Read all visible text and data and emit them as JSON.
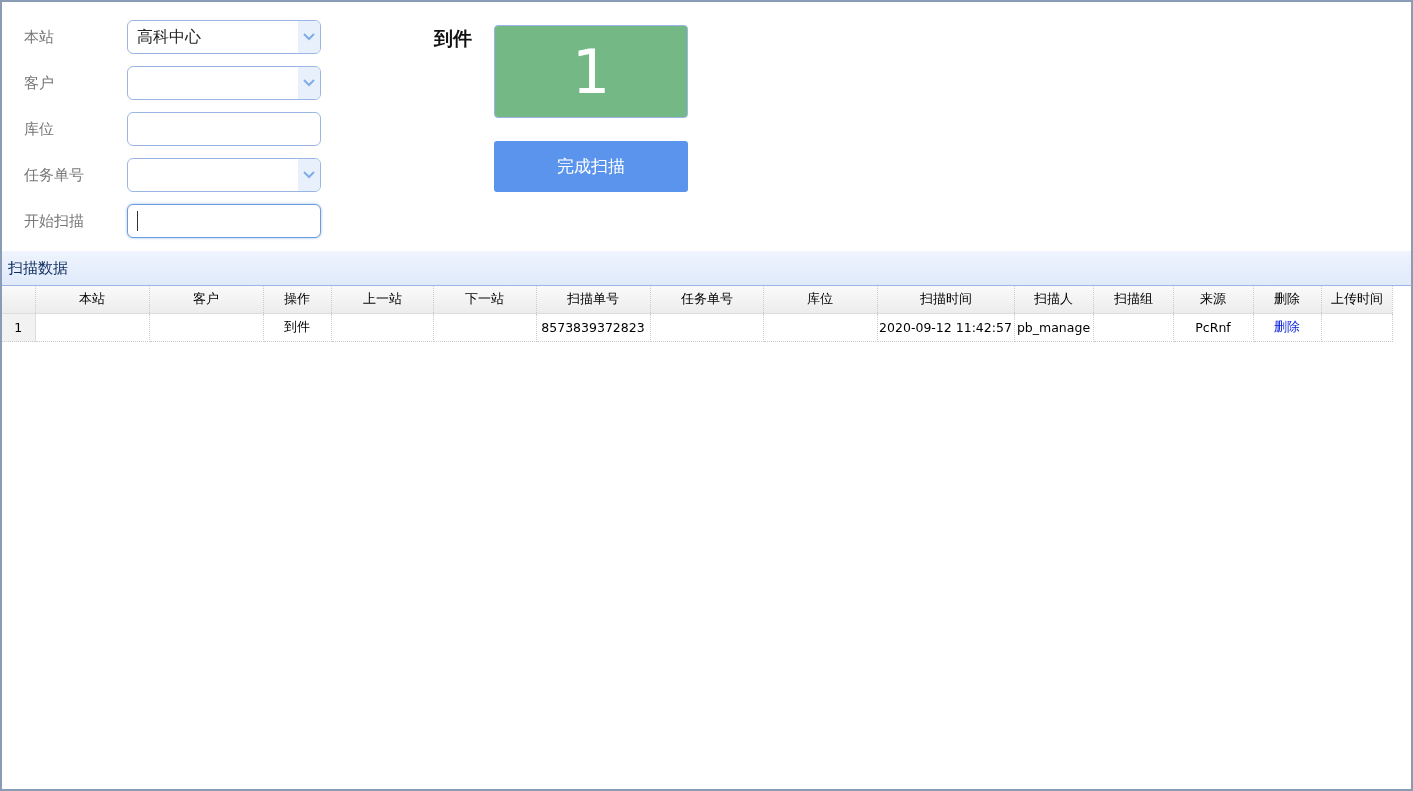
{
  "form": {
    "fields": [
      {
        "label": "本站",
        "kind": "select",
        "value": "高科中心",
        "focused": false
      },
      {
        "label": "客户",
        "kind": "select",
        "focused": false
      },
      {
        "label": "库位",
        "kind": "text",
        "focused": false
      },
      {
        "label": "任务单号",
        "kind": "select",
        "focused": false
      },
      {
        "label": "开始扫描",
        "kind": "text",
        "focused": true
      }
    ]
  },
  "counter": {
    "label": "到件",
    "count": "1"
  },
  "finish_button": "完成扫描",
  "panel": {
    "title": "扫描数据"
  },
  "table": {
    "columns": [
      "本站",
      "客户",
      "操作",
      "上一站",
      "下一站",
      "扫描单号",
      "任务单号",
      "库位",
      "扫描时间",
      "扫描人",
      "扫描组",
      "来源",
      "删除",
      "上传时间"
    ],
    "rows": [
      {
        "number": "1",
        "cells": [
          {
            "kind": "text"
          },
          {
            "kind": "text"
          },
          {
            "kind": "text",
            "text": "到件"
          },
          {
            "kind": "text"
          },
          {
            "kind": "text"
          },
          {
            "kind": "text",
            "text": "8573839372823"
          },
          {
            "kind": "text"
          },
          {
            "kind": "text"
          },
          {
            "kind": "text",
            "text": "2020-09-12 11:42:57"
          },
          {
            "kind": "text",
            "text": "pb_manage"
          },
          {
            "kind": "text"
          },
          {
            "kind": "text",
            "text": "PcRnf"
          },
          {
            "kind": "link",
            "text": "删除"
          },
          {
            "kind": "text"
          }
        ]
      }
    ]
  }
}
